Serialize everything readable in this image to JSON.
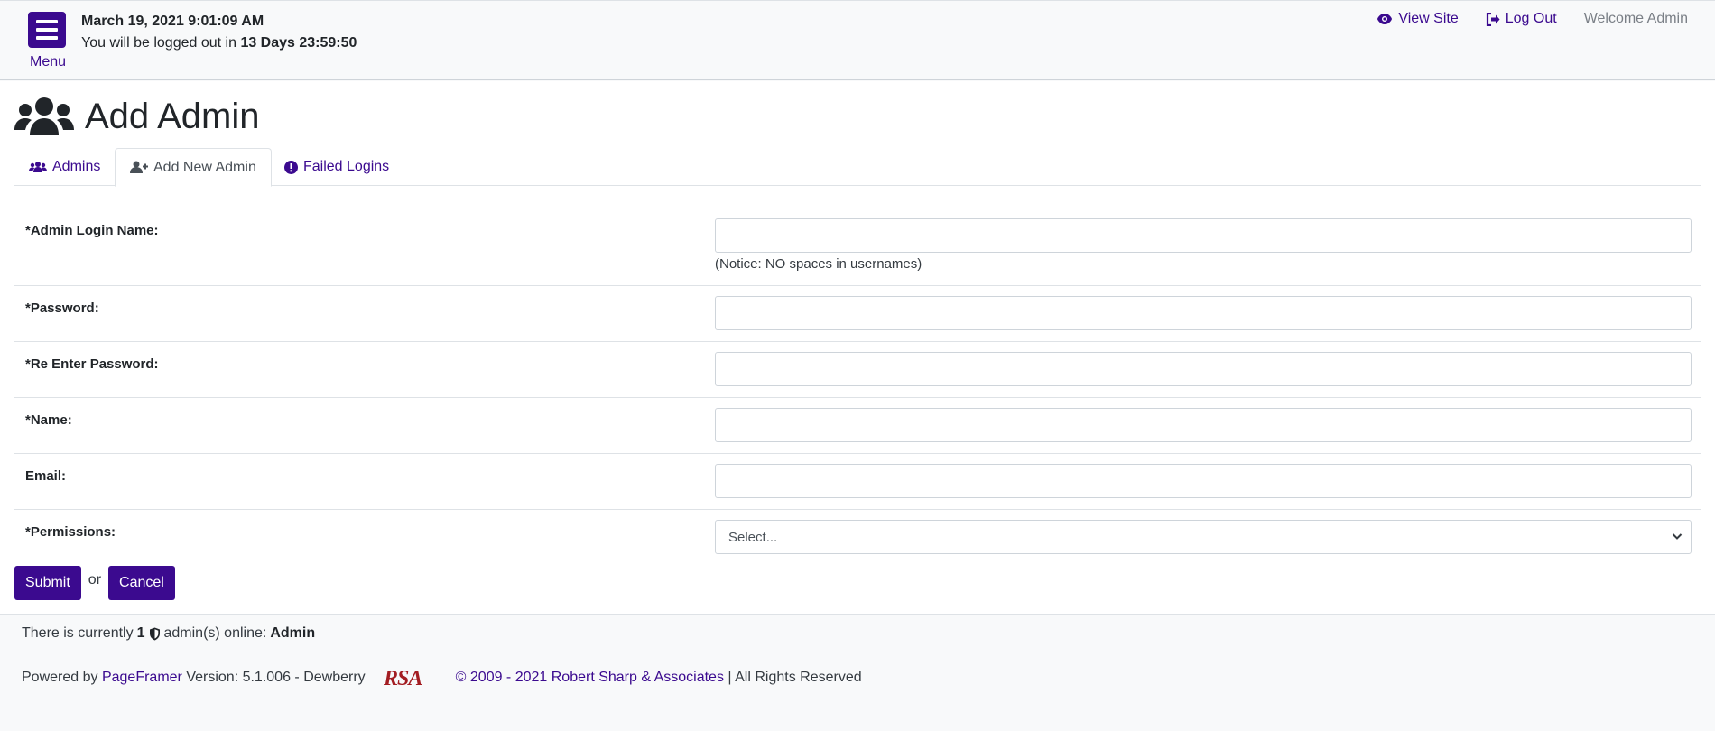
{
  "header": {
    "menu_label": "Menu",
    "datetime": "March 19, 2021 9:01:09 AM",
    "logout_prefix": "You will be logged out in",
    "logout_countdown": "13 Days 23:59:50",
    "view_site": "View Site",
    "log_out": "Log Out",
    "welcome": "Welcome Admin"
  },
  "page": {
    "title": "Add Admin"
  },
  "tabs": [
    {
      "label": "Admins",
      "icon": "users-icon"
    },
    {
      "label": "Add New Admin",
      "icon": "user-plus-icon",
      "active": true
    },
    {
      "label": "Failed Logins",
      "icon": "exclamation-circle-icon"
    }
  ],
  "form": {
    "login_label": "*Admin Login Name:",
    "login_value": "",
    "login_notice": "(Notice: NO spaces in usernames)",
    "password_label": "*Password:",
    "password_value": "",
    "reenter_label": "*Re Enter Password:",
    "reenter_value": "",
    "name_label": "*Name:",
    "name_value": "",
    "email_label": "Email:",
    "email_value": "",
    "permissions_label": "*Permissions:",
    "permissions_selected": "Select..."
  },
  "actions": {
    "submit": "Submit",
    "or": "or",
    "cancel": "Cancel"
  },
  "footer": {
    "online_prefix": "There is currently",
    "online_count": "1",
    "online_suffix": "admin(s) online:",
    "online_user": "Admin",
    "powered_by": "Powered by",
    "product": "PageFramer",
    "version": "Version: 5.1.006 - Dewberry",
    "logo_text": "RSA",
    "copyright": "© 2009 - 2021 Robert Sharp & Associates",
    "rights": "| All Rights Reserved"
  },
  "colors": {
    "accent": "#3b0a8f",
    "logo_red": "#a31d22"
  }
}
